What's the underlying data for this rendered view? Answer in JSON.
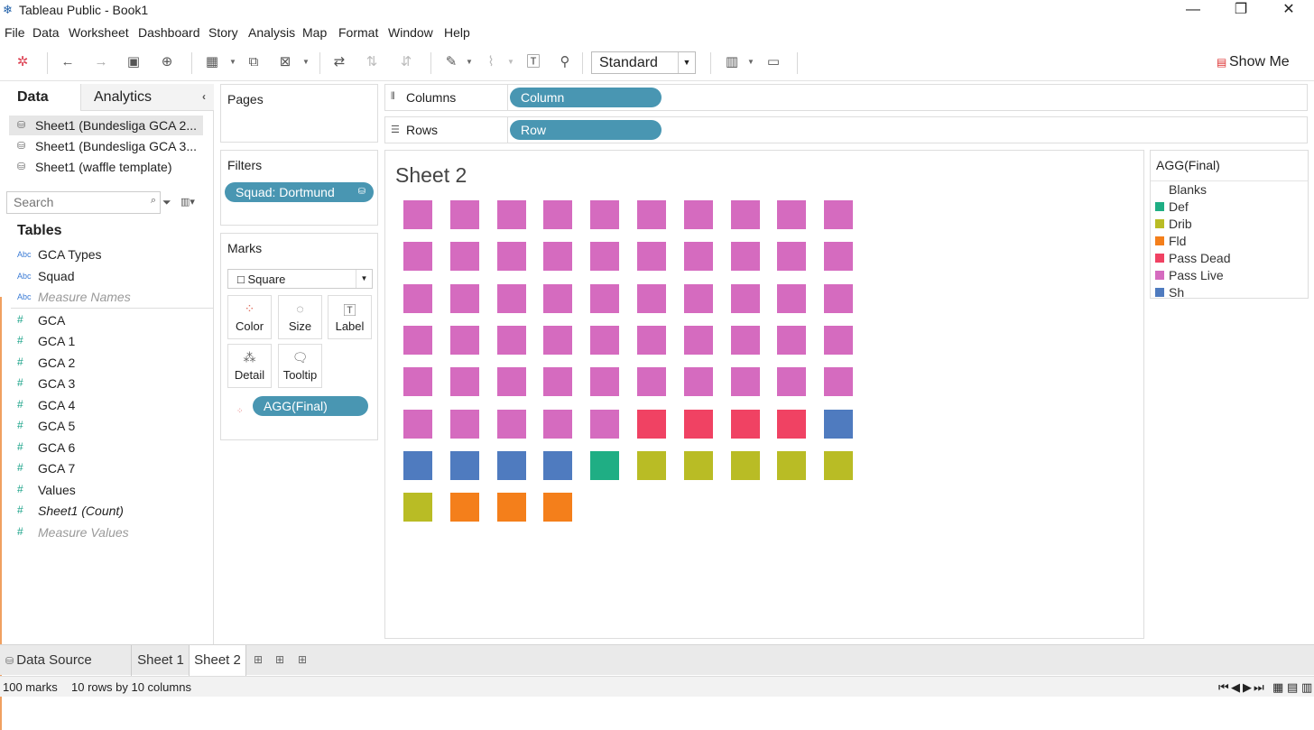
{
  "titlebar": {
    "title": "Tableau Public - Book1",
    "minimize": "—",
    "restore": "❐",
    "close": "✕"
  },
  "menu": [
    "File",
    "Data",
    "Worksheet",
    "Dashboard",
    "Story",
    "Analysis",
    "Map",
    "Format",
    "Window",
    "Help"
  ],
  "toolbar": {
    "fit_select": "Standard",
    "show_me": "Show Me"
  },
  "left_pane": {
    "tab_data": "Data",
    "tab_analytics": "Analytics",
    "data_sources": [
      "Sheet1 (Bundesliga GCA 2...",
      "Sheet1 (Bundesliga GCA 3...",
      "Sheet1 (waffle template)"
    ],
    "search_placeholder": "Search",
    "tables_heading": "Tables",
    "dimensions": [
      "GCA Types",
      "Squad",
      "Measure Names"
    ],
    "measures": [
      "GCA",
      "GCA 1",
      "GCA 2",
      "GCA 3",
      "GCA 4",
      "GCA 5",
      "GCA 6",
      "GCA 7",
      "Values",
      "Sheet1 (Count)",
      "Measure Values"
    ],
    "type_abc": "Abc",
    "type_measure": "#"
  },
  "pages": {
    "heading": "Pages"
  },
  "filters": {
    "heading": "Filters",
    "pill": "Squad: Dortmund"
  },
  "marks": {
    "heading": "Marks",
    "type": "Square",
    "buttons": [
      "Color",
      "Size",
      "Label",
      "Detail",
      "Tooltip"
    ],
    "pill": "AGG(Final)"
  },
  "shelves": {
    "columns_label": "Columns",
    "columns_pill": "Column",
    "rows_label": "Rows",
    "rows_pill": "Row"
  },
  "sheet": {
    "title": "Sheet 2"
  },
  "legend": {
    "title": "AGG(Final)",
    "items": [
      {
        "label": "Blanks",
        "color": ""
      },
      {
        "label": "Def",
        "color": "#1fae84"
      },
      {
        "label": "Drib",
        "color": "#b9bc25"
      },
      {
        "label": "Fld",
        "color": "#f47f1b"
      },
      {
        "label": "Pass Dead",
        "color": "#f04263"
      },
      {
        "label": "Pass Live",
        "color": "#d56bbf"
      },
      {
        "label": "Sh",
        "color": "#4f7bbf"
      }
    ]
  },
  "chart_data": {
    "type": "heatmap",
    "title": "Sheet 2",
    "columns": 10,
    "rows": 8,
    "cells": [
      [
        "Pass Live",
        "Pass Live",
        "Pass Live",
        "Pass Live",
        "Pass Live",
        "Pass Live",
        "Pass Live",
        "Pass Live",
        "Pass Live",
        "Pass Live"
      ],
      [
        "Pass Live",
        "Pass Live",
        "Pass Live",
        "Pass Live",
        "Pass Live",
        "Pass Live",
        "Pass Live",
        "Pass Live",
        "Pass Live",
        "Pass Live"
      ],
      [
        "Pass Live",
        "Pass Live",
        "Pass Live",
        "Pass Live",
        "Pass Live",
        "Pass Live",
        "Pass Live",
        "Pass Live",
        "Pass Live",
        "Pass Live"
      ],
      [
        "Pass Live",
        "Pass Live",
        "Pass Live",
        "Pass Live",
        "Pass Live",
        "Pass Live",
        "Pass Live",
        "Pass Live",
        "Pass Live",
        "Pass Live"
      ],
      [
        "Pass Live",
        "Pass Live",
        "Pass Live",
        "Pass Live",
        "Pass Live",
        "Pass Live",
        "Pass Live",
        "Pass Live",
        "Pass Live",
        "Pass Live"
      ],
      [
        "Pass Live",
        "Pass Live",
        "Pass Live",
        "Pass Live",
        "Pass Live",
        "Pass Dead",
        "Pass Dead",
        "Pass Dead",
        "Pass Dead",
        "Sh"
      ],
      [
        "Sh",
        "Sh",
        "Sh",
        "Sh",
        "Def",
        "Drib",
        "Drib",
        "Drib",
        "Drib",
        "Drib"
      ],
      [
        "Drib",
        "Fld",
        "Fld",
        "Fld"
      ]
    ],
    "counts": {
      "Pass Live": 55,
      "Pass Dead": 4,
      "Sh": 5,
      "Def": 1,
      "Drib": 6,
      "Fld": 3
    }
  },
  "sheet_tabs": [
    "Data Source",
    "Sheet 1",
    "Sheet 2"
  ],
  "status": {
    "marks": "100 marks",
    "dims": "10 rows by 10 columns"
  }
}
